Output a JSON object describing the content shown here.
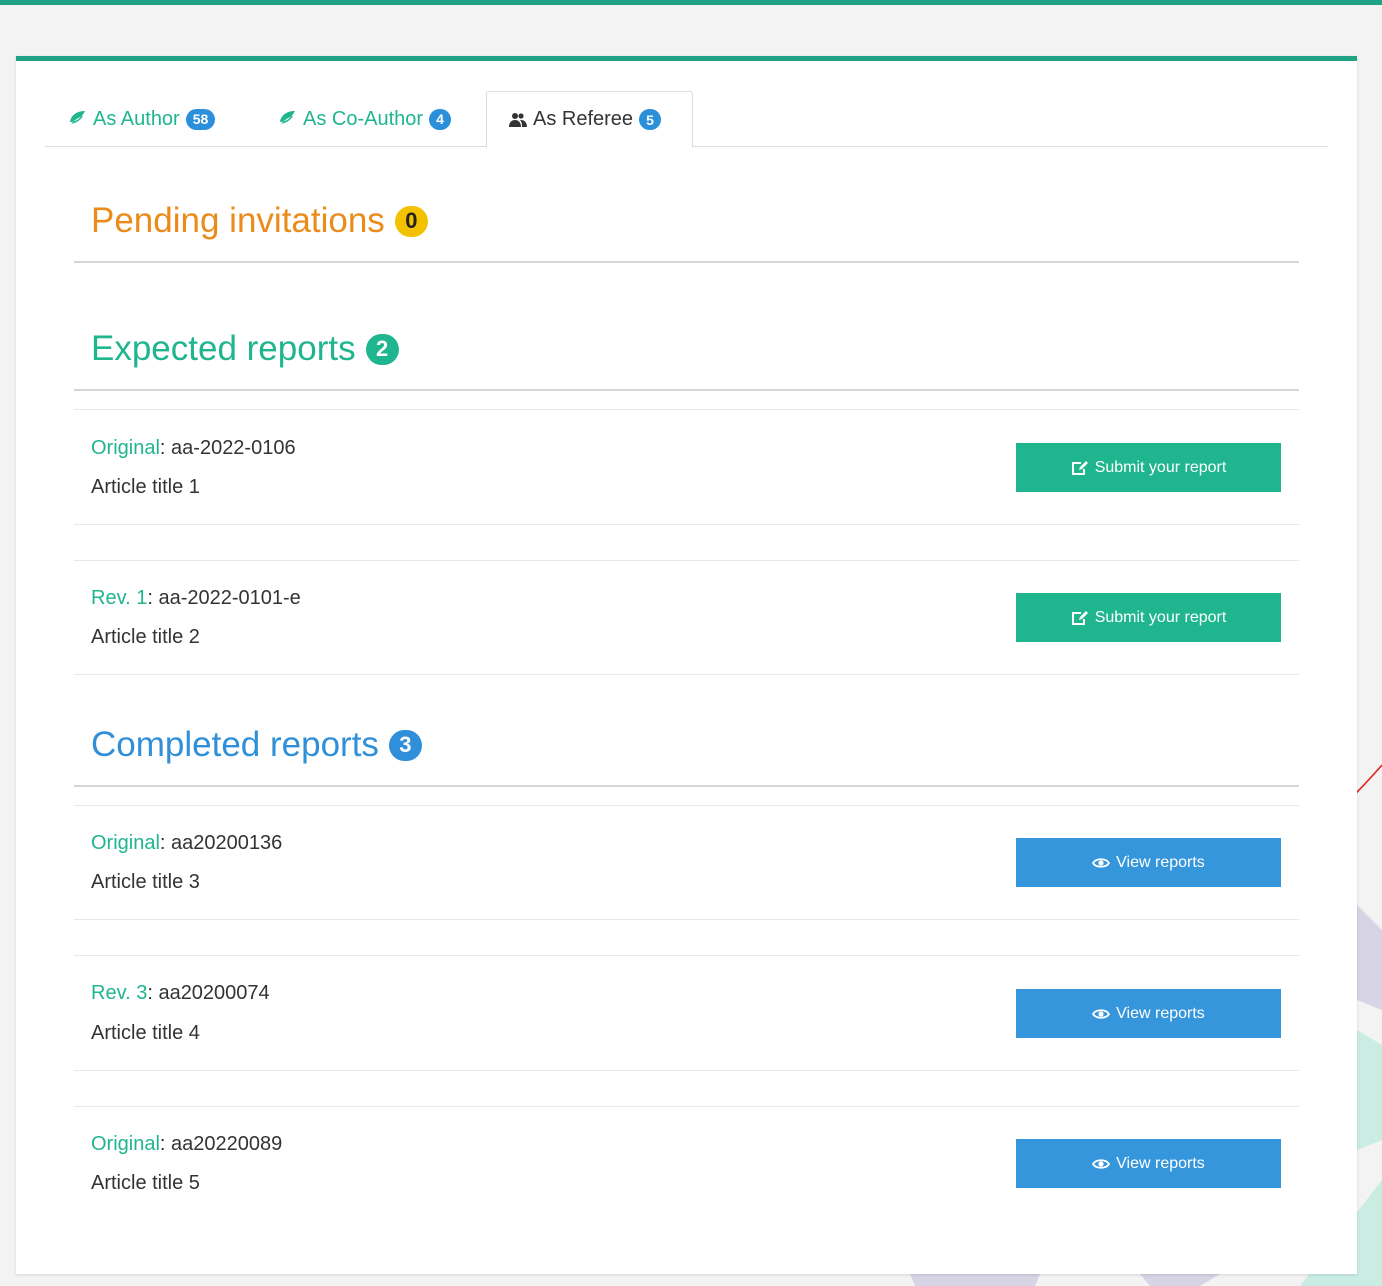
{
  "tabs": [
    {
      "label": "As Author",
      "count": "58",
      "icon": "leaf-icon",
      "active": false
    },
    {
      "label": "As Co-Author",
      "count": "4",
      "icon": "leaf-icon",
      "active": false
    },
    {
      "label": "As Referee",
      "count": "5",
      "icon": "users-icon",
      "active": true
    }
  ],
  "pending": {
    "title": "Pending invitations",
    "count": "0"
  },
  "expected": {
    "title": "Expected reports",
    "count": "2",
    "items": [
      {
        "kind": "Original",
        "ref": ": aa-2022-0106",
        "title": "Article title 1",
        "button": "Submit your report",
        "icon": "edit-icon"
      },
      {
        "kind": "Rev. 1",
        "ref": ": aa-2022-0101-e",
        "title": "Article title 2",
        "button": "Submit your report",
        "icon": "edit-icon"
      }
    ]
  },
  "completed": {
    "title": "Completed reports",
    "count": "3",
    "items": [
      {
        "kind": "Original",
        "ref": ": aa20200136",
        "title": "Article title 3",
        "button": "View reports",
        "icon": "eye-icon"
      },
      {
        "kind": "Rev. 3",
        "ref": ": aa20200074",
        "title": "Article title 4",
        "button": "View reports",
        "icon": "eye-icon"
      },
      {
        "kind": "Original",
        "ref": ": aa20220089",
        "title": "Article title 5",
        "button": "View reports",
        "icon": "eye-icon"
      }
    ]
  },
  "colors": {
    "accent": "#1fa384",
    "green": "#1fb58f",
    "blue": "#3596dc",
    "orange": "#ea8b1a",
    "yellow": "#f2c200"
  }
}
